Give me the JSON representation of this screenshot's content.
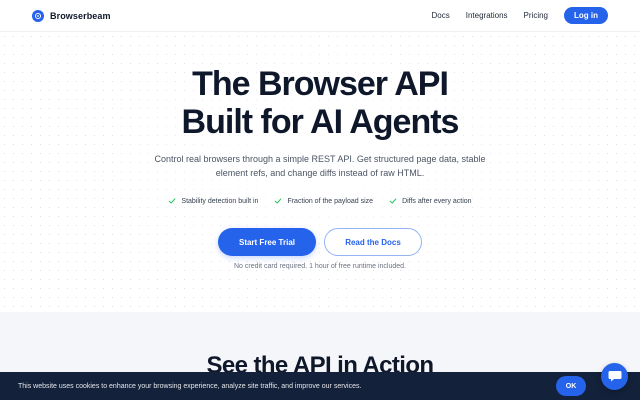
{
  "header": {
    "brand": "Browserbeam",
    "nav": [
      "Docs",
      "Integrations",
      "Pricing"
    ],
    "login": "Log in",
    "brand_icon": "compass-logo-icon"
  },
  "hero": {
    "title_line1": "The Browser API",
    "title_line2": "Built for AI Agents",
    "subtitle_line1": "Control real browsers through a simple REST API. Get structured page data, stable",
    "subtitle_line2": "element refs, and change diffs instead of raw HTML.",
    "features": [
      "Stability detection built in",
      "Fraction of the payload size",
      "Diffs after every action"
    ],
    "feature_icon": "check-icon",
    "cta_primary": "Start Free Trial",
    "cta_secondary": "Read the Docs",
    "note": "No credit card required. 1 hour of free runtime included."
  },
  "section": {
    "title": "See the API in Action"
  },
  "cookie": {
    "text": "This website uses cookies to enhance your browsing experience, analyze site traffic, and improve our services.",
    "ok": "OK"
  },
  "chat": {
    "icon": "chat-bubble-icon"
  },
  "colors": {
    "accent": "#2563eb",
    "dark": "#0f172a",
    "cookie_bg": "#14213a"
  }
}
